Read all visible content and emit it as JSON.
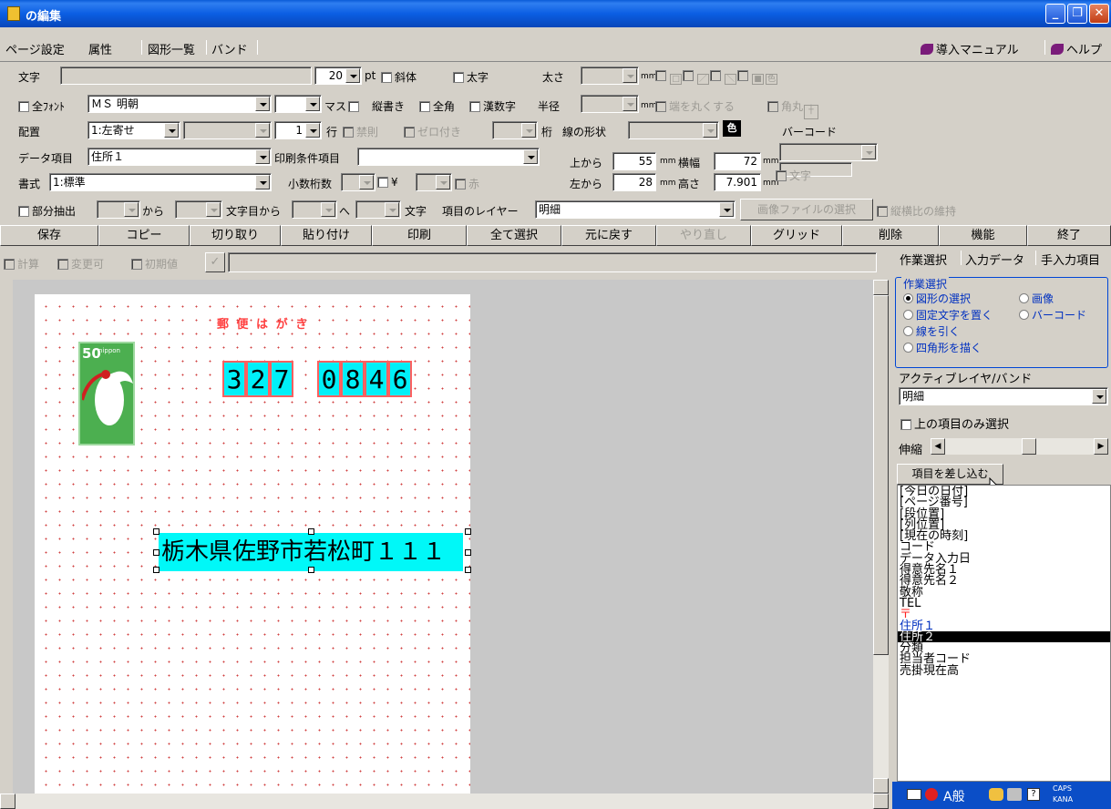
{
  "window": {
    "title": "の編集"
  },
  "menu": {
    "tabs": [
      "ページ設定",
      "属性",
      "図形一覧",
      "バンド"
    ],
    "manual": "導入マニュアル",
    "help": "ヘルプ"
  },
  "props": {
    "text_label": "文字",
    "font_size": "20",
    "pt": "pt",
    "italic": "斜体",
    "bold": "太字",
    "weight": "太さ",
    "mm": "mm",
    "allfont": "全ﾌｫﾝﾄ",
    "font": "ＭＳ 明朝",
    "masu": "マス",
    "vertical": "縦書き",
    "fullwidth": "全角",
    "kanji_num": "漢数字",
    "radius": "半径",
    "round_ends": "端を丸くする",
    "kakumaru": "角丸",
    "align_label": "配置",
    "align": "1:左寄せ",
    "lines": "1",
    "gyo": "行",
    "kinsoku": "禁則",
    "zero_fill": "ゼロ付き",
    "keta": "桁",
    "line_shape": "線の形状",
    "color_btn": "色",
    "barcode": "バーコード",
    "data_item_label": "データ項目",
    "data_item": "住所１",
    "print_cond_label": "印刷条件項目",
    "top_label": "上から",
    "top": "55",
    "width_label": "横幅",
    "width": "72",
    "left_label": "左から",
    "left": "28",
    "height_label": "高さ",
    "height": "7.901",
    "moji": "文字",
    "format_label": "書式",
    "format": "1:標準",
    "decimals_label": "小数桁数",
    "yen": "¥",
    "red": "赤",
    "partial": "部分抽出",
    "from": "から",
    "char_from": "文字目から",
    "to": "へ",
    "moji2": "文字",
    "layer_label": "項目のレイヤー",
    "layer": "明細",
    "image_select": "画像ファイルの選択",
    "keep_ratio": "縦横比の維持"
  },
  "toolbar": [
    "保存",
    "コピー",
    "切り取り",
    "貼り付け",
    "印刷",
    "全て選択",
    "元に戻す",
    "やり直し",
    "グリッド",
    "削除",
    "機能",
    "終了"
  ],
  "calc_row": {
    "calc": "計算",
    "changeable": "変更可",
    "initial": "初期値",
    "check": "✓"
  },
  "postcard": {
    "header": "郵 便 は が き",
    "stamp_value": "50",
    "stamp_text": "nippon",
    "zip": [
      "3",
      "2",
      "7",
      "0",
      "8",
      "4",
      "6"
    ],
    "address": "栃木県佐野市若松町１１１"
  },
  "right_panel": {
    "tabs": [
      "作業選択",
      "入力データ",
      "手入力項目"
    ],
    "group_title": "作業選択",
    "options": [
      "図形の選択",
      "画像",
      "固定文字を置く",
      "バーコード",
      "線を引く",
      "四角形を描く"
    ],
    "active_layer_label": "アクティブレイヤ/バンド",
    "active_layer": "明細",
    "only_above": "上の項目のみ選択",
    "stretch": "伸縮",
    "insert_button": "項目を差し込む",
    "items": [
      "[今日の日付]",
      "[ページ番号]",
      "[段位置]",
      "[列位置]",
      "[現在の時刻]",
      "コード",
      "データ入力日",
      "得意先名１",
      "得意先名２",
      "敬称",
      "TEL",
      "〒",
      "住所１",
      "住所２",
      "分類",
      "担当者コード",
      "売掛現在高"
    ]
  },
  "taskbar": {
    "ime": "A般",
    "caps": "CAPS",
    "kana": "KANA"
  },
  "colors": {
    "title_bar": "#0b5ee3",
    "highlight_cyan": "#00f8f8",
    "selected": "#000000",
    "link_blue": "#0030c0",
    "postal_red": "#ff3030"
  }
}
